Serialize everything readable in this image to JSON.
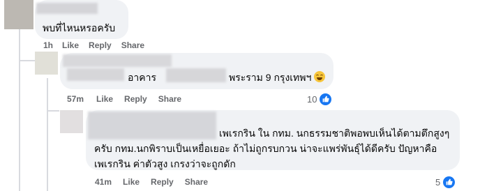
{
  "comments": [
    {
      "text_lines": [
        "พบที่ไหนหรอครับ"
      ],
      "time": "1h",
      "actions": [
        "Like",
        "Reply",
        "Share"
      ]
    },
    {
      "text_parts": [
        "อาคาร",
        "พระราม 9 กรุงเทพฯ"
      ],
      "emoji": "grinning-face-emoji",
      "time": "57m",
      "actions": [
        "Like",
        "Reply",
        "Share"
      ],
      "reaction_count": "10"
    },
    {
      "text_lines": [
        "เพเรกริน ใน กทม. นกธรรมชาติพอพบเห็นได้ตามตึกสูงๆ",
        "ครับ กทม.นกพิราบเป็นเหยื่อเยอะ ถ้าไม่ถูกรบกวน น่าจะแพร่พันธุ์ได้ดีครับ ปัญหาคือ",
        "เพเรกริน ค่าตัวสูง เกรงว่าจะถูกดัก"
      ],
      "time": "41m",
      "actions": [
        "Like",
        "Reply",
        "Share"
      ],
      "reaction_count": "5"
    }
  ],
  "colors": {
    "bubble": "#f0f2f5",
    "meta_text": "#65676b",
    "like_blue": "#1877f2"
  }
}
